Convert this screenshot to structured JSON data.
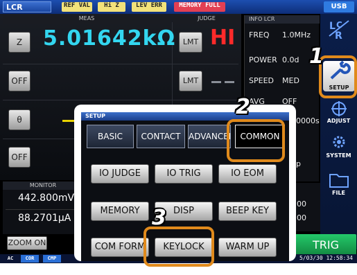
{
  "topbar": {
    "tab": "LCR",
    "flags": [
      "REF VAL",
      "Hi Z",
      "LEV ERR",
      "MEMORY FULL"
    ],
    "usb": "USB"
  },
  "measure": {
    "meas_header": "MEAS",
    "judge_header": "JUDGE",
    "param_buttons": [
      "Z",
      "OFF",
      "θ",
      "OFF"
    ],
    "value": "5.01642kΩ",
    "limit_buttons": [
      "LMT",
      "LMT"
    ],
    "judge_result": "HI"
  },
  "info": {
    "title": "INFO LCR",
    "rows": [
      {
        "label": "FREQ",
        "value": "1.0MHz"
      },
      {
        "label": "POWER",
        "value": "0.0d"
      },
      {
        "label": "SPEED",
        "value": "MED"
      },
      {
        "label": "AVG",
        "value": "OFF"
      }
    ],
    "partial": [
      "0000s",
      "p",
      "00",
      "00"
    ]
  },
  "side": {
    "items": [
      "SETUP",
      "ADJUST",
      "SYSTEM",
      "FILE"
    ]
  },
  "monitor": {
    "title": "MONITOR",
    "values": [
      "442.800mV",
      "88.2701μA"
    ],
    "zoom": "ZOOM ON"
  },
  "trig": "TRIG",
  "statusbar": {
    "items": [
      "AC",
      "COR",
      "CMP"
    ],
    "clock": "5/03/30 12:58:34"
  },
  "dialog": {
    "title": "SETUP",
    "tabs": [
      "BASIC",
      "CONTACT",
      "ADVANCED",
      "COMMON"
    ],
    "active_tab": "COMMON",
    "buttons": [
      "IO JUDGE",
      "IO TRIG",
      "IO EOM",
      "MEMORY",
      "DISP",
      "BEEP KEY",
      "COM FORM",
      "KEYLOCK",
      "WARM UP"
    ]
  },
  "callouts": [
    "1",
    "2",
    "3"
  ],
  "colors": {
    "highlight": "#e08a1c",
    "value": "#33d6f0",
    "judge_hi": "#ff2a2a",
    "trig": "#1aa555"
  }
}
